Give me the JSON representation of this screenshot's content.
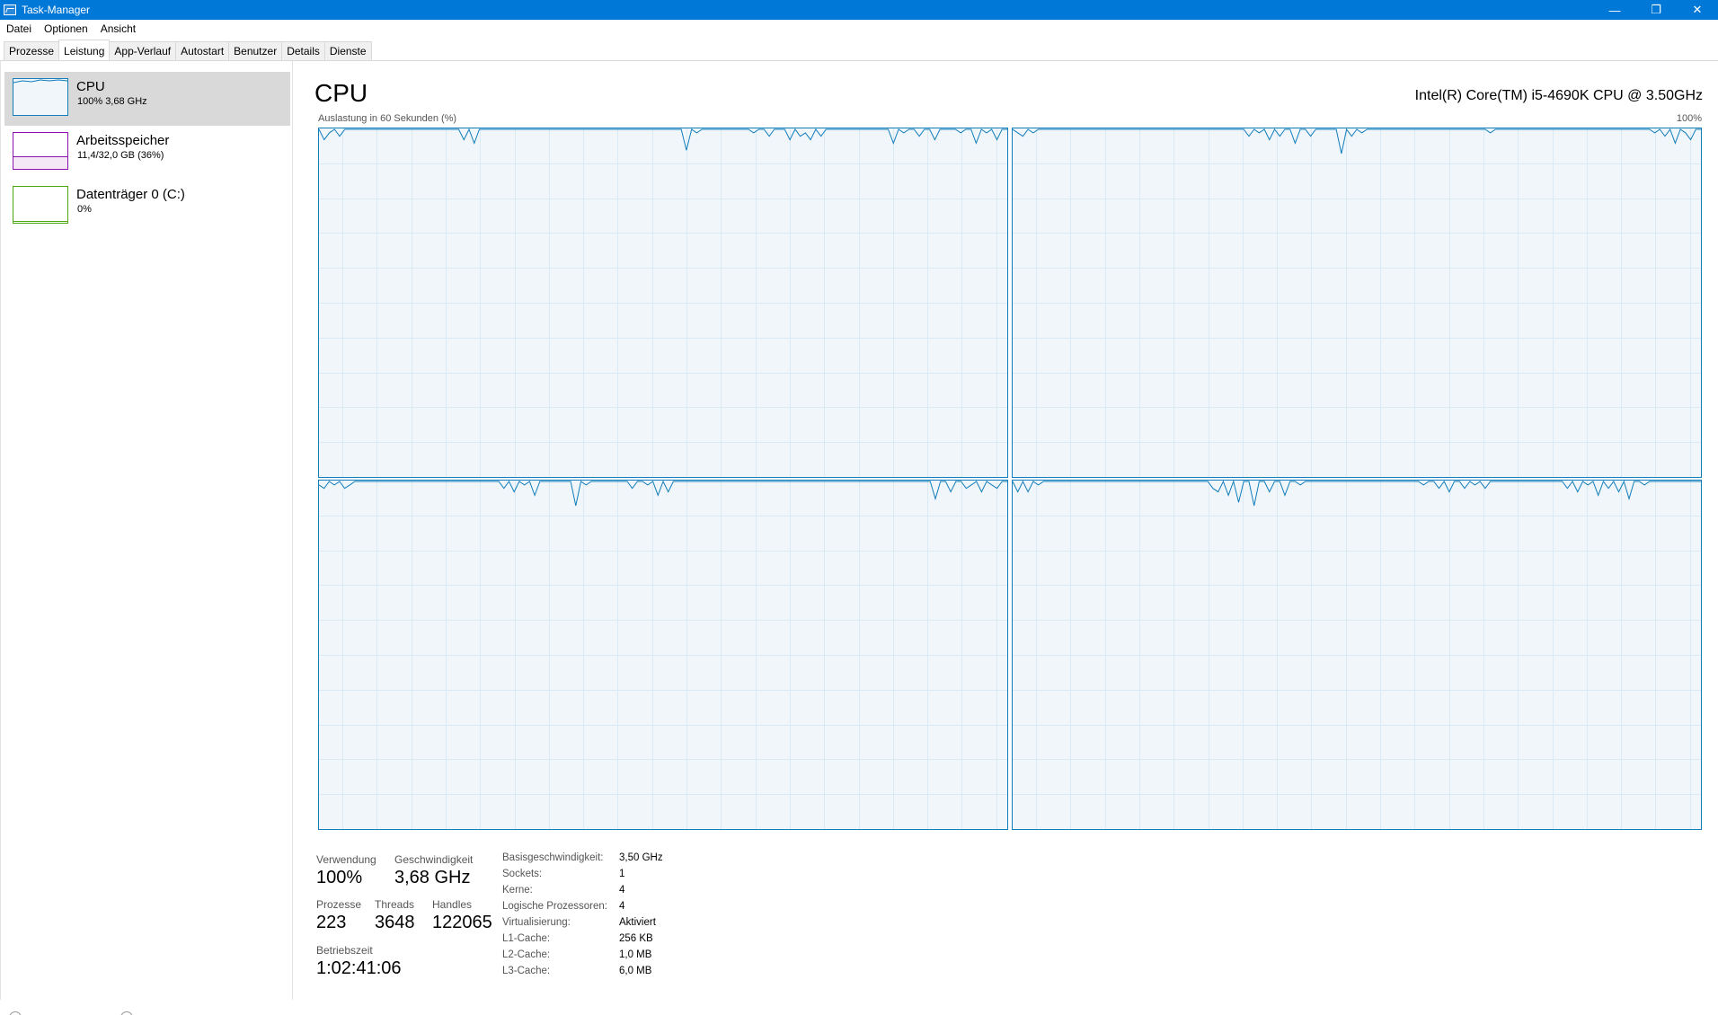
{
  "window": {
    "title": "Task-Manager",
    "minimize_glyph": "—",
    "restore_glyph": "❐",
    "close_glyph": "✕"
  },
  "menu": [
    "Datei",
    "Optionen",
    "Ansicht"
  ],
  "tabs": [
    "Prozesse",
    "Leistung",
    "App-Verlauf",
    "Autostart",
    "Benutzer",
    "Details",
    "Dienste"
  ],
  "active_tab": "Leistung",
  "sidebar": {
    "items": [
      {
        "name": "CPU",
        "detail": "100%  3,68 GHz",
        "color": "#117dbb",
        "selected": true
      },
      {
        "name": "Arbeitsspeicher",
        "detail": "11,4/32,0 GB (36%)",
        "color": "#8b12ae",
        "selected": false
      },
      {
        "name": "Datenträger 0 (C:)",
        "detail": "0%",
        "color": "#4da60c",
        "selected": false
      }
    ]
  },
  "main": {
    "heading": "CPU",
    "cpu_model": "Intel(R) Core(TM) i5-4690K CPU @ 3.50GHz",
    "util_label": "Auslastung in 60 Sekunden (%)",
    "util_max": "100%",
    "graph_color": "#117dbb",
    "graph_bg": "#f1f6fa",
    "grid_color": "#d9eaf4"
  },
  "chart_data": {
    "type": "line",
    "title": "Auslastung in 60 Sekunden (%)",
    "ylim": [
      0,
      100
    ],
    "xlim": [
      60,
      0
    ],
    "grid": true,
    "series": [
      {
        "values": [
          100,
          97,
          99,
          100,
          98,
          100,
          100,
          100,
          100,
          100,
          100,
          100,
          100,
          100,
          100,
          100,
          100,
          100,
          100,
          100,
          100,
          100,
          100,
          100,
          100,
          100,
          100,
          100,
          97,
          100,
          96,
          100,
          100,
          100,
          100,
          100,
          100,
          100,
          100,
          100,
          100,
          100,
          100,
          100,
          100,
          100,
          100,
          100,
          100,
          100,
          100,
          100,
          100,
          100,
          100,
          100,
          100,
          100,
          100,
          100,
          100,
          100,
          100,
          100,
          100,
          100,
          100,
          100,
          100,
          100,
          100,
          94,
          100,
          99,
          100,
          100,
          100,
          100,
          100,
          100,
          100,
          100,
          100,
          100,
          99,
          100,
          100,
          98,
          100,
          100,
          100,
          97,
          100,
          98,
          99,
          97,
          100,
          98,
          100,
          100,
          100,
          100,
          100,
          100,
          100,
          100,
          100,
          100,
          100,
          100,
          100,
          96,
          100,
          99,
          100,
          100,
          98,
          100,
          100,
          97,
          100,
          100,
          100,
          100,
          99,
          100,
          100,
          96,
          100,
          99,
          100,
          97,
          100,
          100
        ]
      },
      {
        "values": [
          100,
          99,
          98,
          100,
          99,
          100,
          100,
          100,
          100,
          100,
          100,
          100,
          100,
          100,
          100,
          100,
          100,
          100,
          100,
          100,
          100,
          100,
          100,
          100,
          100,
          100,
          100,
          100,
          100,
          100,
          100,
          100,
          100,
          100,
          100,
          100,
          100,
          100,
          100,
          100,
          100,
          100,
          100,
          100,
          100,
          100,
          98,
          100,
          99,
          100,
          97,
          100,
          98,
          100,
          100,
          96,
          100,
          100,
          98,
          100,
          100,
          100,
          100,
          100,
          93,
          100,
          98,
          100,
          99,
          100,
          100,
          100,
          100,
          100,
          100,
          100,
          100,
          100,
          100,
          100,
          100,
          100,
          100,
          100,
          100,
          100,
          100,
          100,
          100,
          100,
          100,
          100,
          100,
          99,
          100,
          100,
          100,
          100,
          100,
          100,
          100,
          100,
          100,
          100,
          100,
          100,
          100,
          100,
          100,
          100,
          100,
          100,
          100,
          100,
          100,
          100,
          100,
          100,
          100,
          100,
          100,
          100,
          100,
          100,
          100,
          99,
          100,
          98,
          100,
          96,
          100,
          99,
          97,
          100,
          100
        ]
      },
      {
        "values": [
          99,
          98,
          100,
          99,
          100,
          98,
          99,
          100,
          100,
          100,
          100,
          100,
          100,
          100,
          100,
          100,
          100,
          100,
          100,
          100,
          100,
          100,
          100,
          100,
          100,
          100,
          100,
          100,
          100,
          100,
          100,
          100,
          100,
          100,
          100,
          100,
          98,
          100,
          97,
          100,
          99,
          100,
          96,
          100,
          100,
          100,
          100,
          100,
          100,
          100,
          93,
          100,
          99,
          100,
          100,
          100,
          100,
          100,
          100,
          100,
          100,
          98,
          100,
          100,
          99,
          100,
          96,
          100,
          97,
          100,
          100,
          100,
          100,
          100,
          100,
          100,
          100,
          100,
          100,
          100,
          100,
          100,
          100,
          100,
          100,
          100,
          100,
          100,
          100,
          100,
          100,
          100,
          100,
          100,
          100,
          100,
          100,
          100,
          100,
          100,
          100,
          100,
          100,
          100,
          100,
          100,
          100,
          100,
          100,
          100,
          100,
          100,
          100,
          100,
          100,
          100,
          100,
          100,
          100,
          100,
          95,
          100,
          100,
          97,
          100,
          100,
          98,
          99,
          100,
          97,
          100,
          99,
          98,
          100,
          100
        ]
      },
      {
        "values": [
          100,
          97,
          100,
          97,
          100,
          99,
          100,
          100,
          100,
          100,
          100,
          100,
          100,
          100,
          100,
          100,
          100,
          100,
          100,
          100,
          100,
          100,
          100,
          100,
          100,
          100,
          100,
          100,
          100,
          100,
          100,
          100,
          100,
          100,
          100,
          100,
          100,
          100,
          100,
          98,
          97,
          100,
          96,
          100,
          94,
          100,
          100,
          93,
          100,
          100,
          97,
          100,
          100,
          96,
          100,
          100,
          99,
          100,
          100,
          100,
          100,
          100,
          100,
          100,
          100,
          100,
          100,
          100,
          100,
          100,
          100,
          100,
          100,
          100,
          100,
          100,
          100,
          100,
          100,
          100,
          99,
          100,
          100,
          98,
          100,
          97,
          100,
          100,
          98,
          100,
          99,
          100,
          98,
          100,
          100,
          100,
          100,
          100,
          100,
          100,
          100,
          100,
          100,
          100,
          100,
          100,
          100,
          100,
          98,
          100,
          97,
          100,
          99,
          100,
          96,
          100,
          98,
          100,
          97,
          100,
          95,
          100,
          100,
          99,
          100,
          100,
          100,
          100,
          100,
          100,
          100,
          100,
          100,
          100,
          100
        ]
      }
    ]
  },
  "stats": {
    "usage": {
      "label": "Verwendung",
      "value": "100%"
    },
    "speed": {
      "label": "Geschwindigkeit",
      "value": "3,68 GHz"
    },
    "processes": {
      "label": "Prozesse",
      "value": "223"
    },
    "threads": {
      "label": "Threads",
      "value": "3648"
    },
    "handles": {
      "label": "Handles",
      "value": "122065"
    },
    "uptime": {
      "label": "Betriebszeit",
      "value": "1:02:41:06"
    }
  },
  "specs": [
    {
      "label": "Basisgeschwindigkeit:",
      "value": "3,50 GHz"
    },
    {
      "label": "Sockets:",
      "value": "1"
    },
    {
      "label": "Kerne:",
      "value": "4"
    },
    {
      "label": "Logische Prozessoren:",
      "value": "4"
    },
    {
      "label": "Virtualisierung:",
      "value": "Aktiviert"
    },
    {
      "label": "L1-Cache:",
      "value": "256 KB"
    },
    {
      "label": "L2-Cache:",
      "value": "1,0 MB"
    },
    {
      "label": "L3-Cache:",
      "value": "6,0 MB"
    }
  ]
}
